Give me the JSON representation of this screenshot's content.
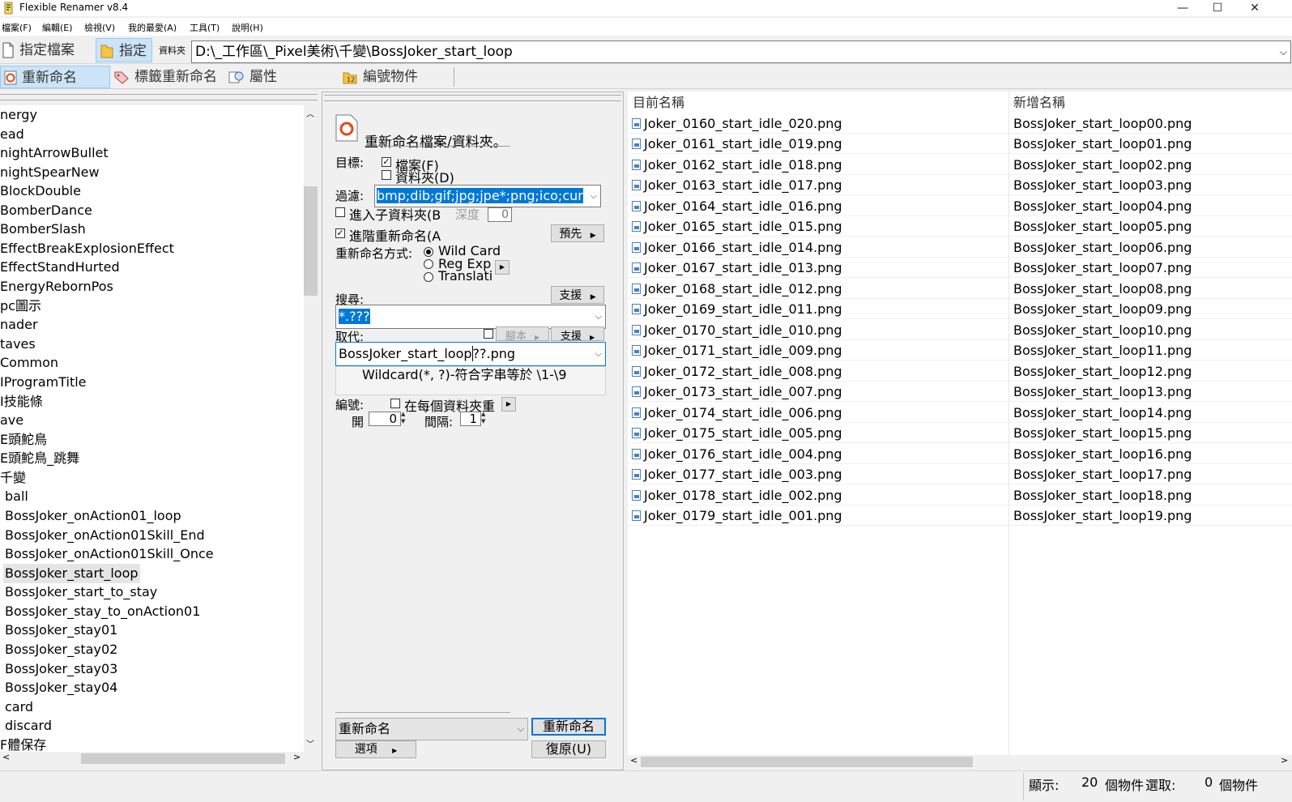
{
  "window": {
    "title": "Flexible Renamer v8.4",
    "minimize": "—",
    "maximize": "☐",
    "close": "✕"
  },
  "menu": [
    "檔案(F)",
    "編輯(E)",
    "檢視(V)",
    "我的最愛(A)",
    "工具(T)",
    "說明(H)"
  ],
  "toolbar": {
    "specify_files": "指定檔案",
    "specify": "指定",
    "folder_label": "資料夾",
    "path": "D:\\_工作區\\_Pixel美術\\千變\\BossJoker_start_loop"
  },
  "tabs": {
    "rename": "重新命名",
    "tag_rename": "標籤重新命名",
    "attributes": "屬性",
    "numbering": "編號物件"
  },
  "tree": {
    "items": [
      "nergy",
      "ead",
      "nightArrowBullet",
      "nightSpearNew",
      "BlockDouble",
      "BomberDance",
      "BomberSlash",
      "EffectBreakExplosionEffect",
      "EffectStandHurted",
      "EnergyRebornPos",
      "pc圖示",
      "nader",
      "taves",
      "Common",
      "IProgramTitle",
      "I技能條",
      "ave",
      "E頭鮀鳥",
      "E頭鮀鳥_跳舞",
      "千變"
    ],
    "children": [
      "ball",
      "BossJoker_onAction01_loop",
      "BossJoker_onAction01Skill_End",
      "BossJoker_onAction01Skill_Once",
      "BossJoker_start_loop",
      "BossJoker_start_to_stay",
      "BossJoker_stay_to_onAction01",
      "BossJoker_stay01",
      "BossJoker_stay02",
      "BossJoker_stay03",
      "BossJoker_stay04",
      "card",
      "discard"
    ],
    "last_item": "F體保存"
  },
  "panel": {
    "header": "重新命名檔案/資料夾。",
    "target_label": "目標:",
    "target_files": "檔案(F)",
    "target_folders": "資料夾(D)",
    "filter_label": "過濾:",
    "filter_value": "bmp;dib;gif;jpg;jpe*;png;ico;cur",
    "subfolders_label": "進入子資料夾(B",
    "depth_label": "深度",
    "depth_value": "0",
    "advanced_label": "進階重新命名(A",
    "preset_button": "預先",
    "method_label": "重新命名方式:",
    "method_wildcard": "Wild Card",
    "method_regexp": "Reg Exp",
    "method_translation": "Translati",
    "search_label": "搜尋:",
    "support_button": "支援",
    "search_value": "*.???",
    "replace_label": "取代:",
    "script_label": "腳本",
    "support_button2": "支援",
    "replace_value_a": "BossJoker_start_loop",
    "replace_value_b": "??.png",
    "hint": "Wildcard(*, ?)-符合字串等於 \\1-\\9",
    "numbering_label": "編號:",
    "per_folder_label": "在每個資料夾重",
    "start_label": "開",
    "start_value": "0",
    "interval_label": "間隔:",
    "interval_value": "1",
    "action_select": "重新命名",
    "rename_button": "重新命名",
    "options_button": "選項",
    "undo_button": "復原(U)"
  },
  "list": {
    "col_current": "目前名稱",
    "col_new": "新增名稱",
    "rows": [
      {
        "cur": "Joker_0160_start_idle_020.png",
        "new": "BossJoker_start_loop00.png"
      },
      {
        "cur": "Joker_0161_start_idle_019.png",
        "new": "BossJoker_start_loop01.png"
      },
      {
        "cur": "Joker_0162_start_idle_018.png",
        "new": "BossJoker_start_loop02.png"
      },
      {
        "cur": "Joker_0163_start_idle_017.png",
        "new": "BossJoker_start_loop03.png"
      },
      {
        "cur": "Joker_0164_start_idle_016.png",
        "new": "BossJoker_start_loop04.png"
      },
      {
        "cur": "Joker_0165_start_idle_015.png",
        "new": "BossJoker_start_loop05.png"
      },
      {
        "cur": "Joker_0166_start_idle_014.png",
        "new": "BossJoker_start_loop06.png"
      },
      {
        "cur": "Joker_0167_start_idle_013.png",
        "new": "BossJoker_start_loop07.png"
      },
      {
        "cur": "Joker_0168_start_idle_012.png",
        "new": "BossJoker_start_loop08.png"
      },
      {
        "cur": "Joker_0169_start_idle_011.png",
        "new": "BossJoker_start_loop09.png"
      },
      {
        "cur": "Joker_0170_start_idle_010.png",
        "new": "BossJoker_start_loop10.png"
      },
      {
        "cur": "Joker_0171_start_idle_009.png",
        "new": "BossJoker_start_loop11.png"
      },
      {
        "cur": "Joker_0172_start_idle_008.png",
        "new": "BossJoker_start_loop12.png"
      },
      {
        "cur": "Joker_0173_start_idle_007.png",
        "new": "BossJoker_start_loop13.png"
      },
      {
        "cur": "Joker_0174_start_idle_006.png",
        "new": "BossJoker_start_loop14.png"
      },
      {
        "cur": "Joker_0175_start_idle_005.png",
        "new": "BossJoker_start_loop15.png"
      },
      {
        "cur": "Joker_0176_start_idle_004.png",
        "new": "BossJoker_start_loop16.png"
      },
      {
        "cur": "Joker_0177_start_idle_003.png",
        "new": "BossJoker_start_loop17.png"
      },
      {
        "cur": "Joker_0178_start_idle_002.png",
        "new": "BossJoker_start_loop18.png"
      },
      {
        "cur": "Joker_0179_start_idle_001.png",
        "new": "BossJoker_start_loop19.png"
      }
    ]
  },
  "status": {
    "display_label": "顯示:",
    "display_count": "20",
    "items_label": "個物件",
    "selected_label": "選取:",
    "selected_count": "0",
    "items_label2": "個物件"
  },
  "colors": {
    "selection": "#0078d7",
    "active_tool": "#cce4f7"
  }
}
